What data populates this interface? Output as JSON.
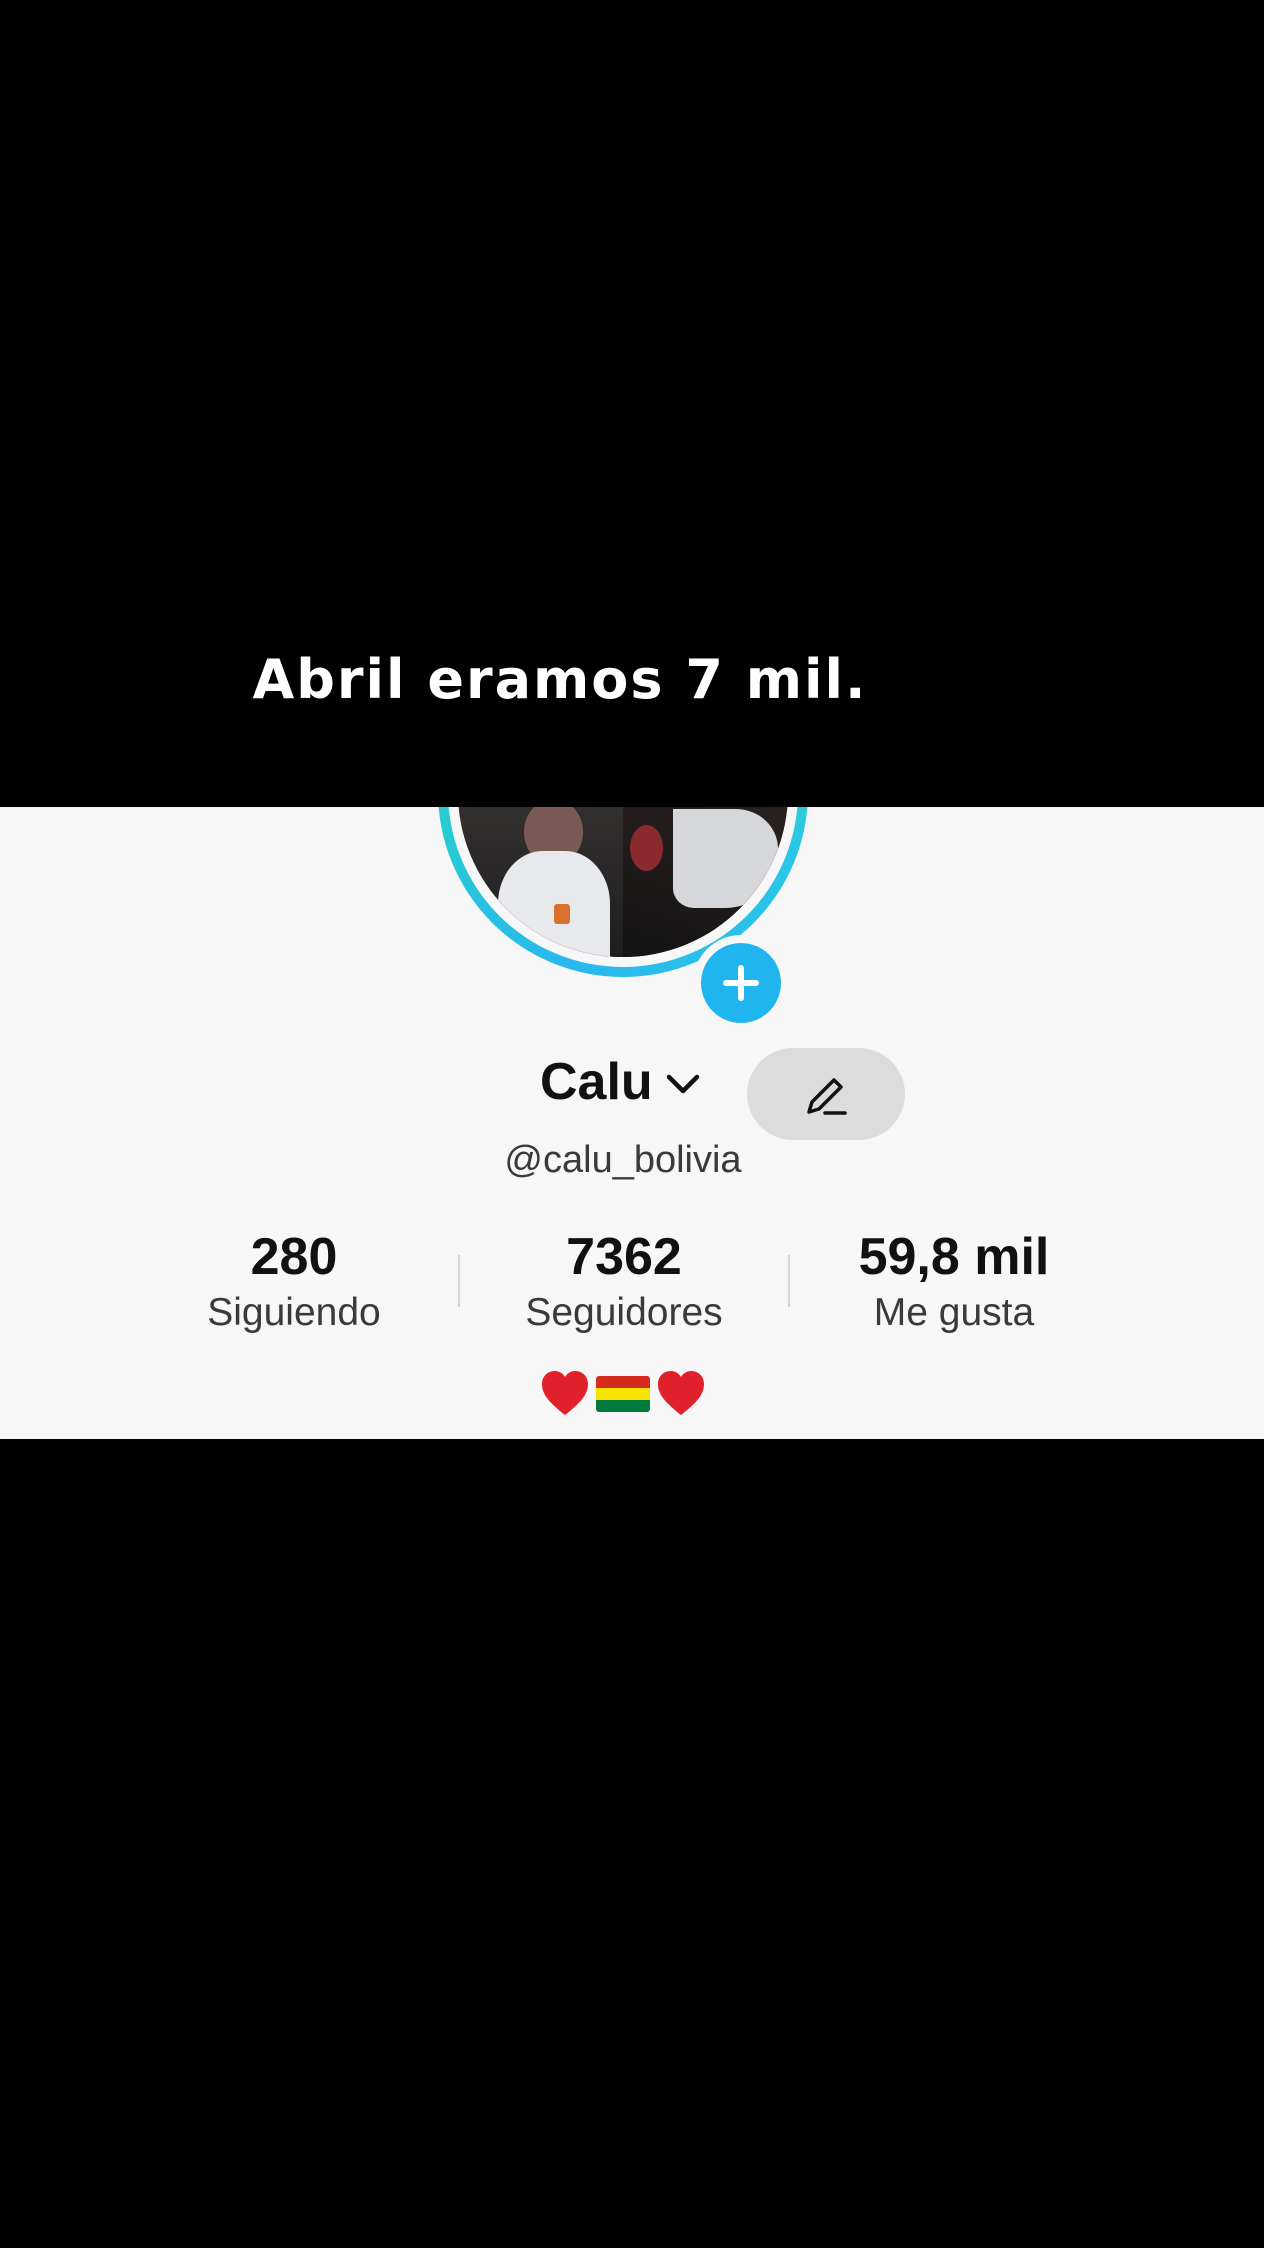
{
  "caption": "Abril eramos 7 mil.",
  "profile": {
    "display_name": "Calu",
    "username": "@calu_bolivia",
    "stats": {
      "following": {
        "value": "280",
        "label": "Siguiendo"
      },
      "followers": {
        "value": "7362",
        "label": "Seguidores"
      },
      "likes": {
        "value": "59,8 mil",
        "label": "Me gusta"
      }
    },
    "bio_icons": [
      "heart-icon",
      "bolivia-flag-icon",
      "heart-icon"
    ]
  },
  "colors": {
    "background": "#000000",
    "card": "#f7f7f8",
    "accent_blue": "#20b5ef",
    "ring_green": "#33e08f",
    "edit_button": "#dcdcdd"
  }
}
